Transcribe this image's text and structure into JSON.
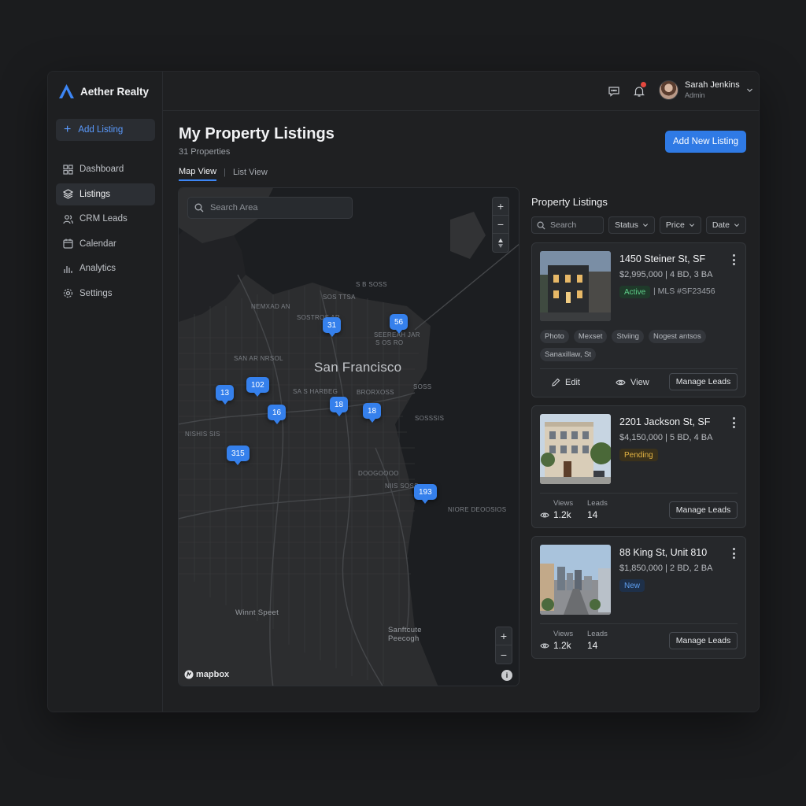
{
  "brand": {
    "name": "Aether Realty",
    "accent": "#3d86f5"
  },
  "sidebar": {
    "add_label": "Add Listing",
    "items": [
      {
        "label": "Dashboard",
        "icon": "grid-icon"
      },
      {
        "label": "Listings",
        "icon": "layers-icon",
        "active": true
      },
      {
        "label": "CRM Leads",
        "icon": "users-icon"
      },
      {
        "label": "Calendar",
        "icon": "calendar-icon"
      },
      {
        "label": "Analytics",
        "icon": "bar-chart-icon"
      },
      {
        "label": "Settings",
        "icon": "gear-icon"
      }
    ]
  },
  "topbar": {
    "user_name": "Sarah Jenkins",
    "user_role": "Admin"
  },
  "page": {
    "title": "My Property Listings",
    "subtitle": "31 Properties",
    "primary_button": "Add New Listing",
    "view_tabs": [
      "Map View",
      "List View"
    ]
  },
  "map": {
    "search_placeholder": "Search Area",
    "city": "San Francisco",
    "labels": [
      "S B SOSS",
      "NEMXAD AN",
      "SAN AR NRSOL",
      "SEEREAH JAR",
      "SOS TTSA",
      "SOSTROS AR",
      "S OS RO",
      "SA S HARBEG",
      "BRORXOSS",
      "NISHIS SIS",
      "SOSS",
      "SOSSSIS",
      "NIIS SOSS",
      "DOOGOOOO",
      "NIORE DEOOSIOS",
      "Winnt Speet",
      "Sanftcute Peecogh"
    ],
    "clusters": [
      "31",
      "56",
      "102",
      "13",
      "16",
      "18",
      "18",
      "315",
      "193"
    ],
    "zoom_in": "+",
    "zoom_out": "−",
    "attribution": "mapbox",
    "info": "i"
  },
  "panel": {
    "title": "Property Listings",
    "search_placeholder": "Search",
    "filters": [
      "Status",
      "Price",
      "Date"
    ],
    "listings": [
      {
        "address": "1450 Steiner St, SF",
        "price_line": "$2,995,000 | 4 BD, 3 BA",
        "status": "Active",
        "status_color": "#3fbf6a",
        "mls": "| MLS #SF23456",
        "tags": [
          "Photo",
          "Mexset",
          "Stviing",
          "Nogest antsos",
          "Sanaxillaw, St"
        ],
        "actions": [
          "Edit",
          "View"
        ],
        "manage": "Manage Leads"
      },
      {
        "address": "2201 Jackson St, SF",
        "price_line": "$4,150,000 | 5 BD, 4 BA",
        "status": "Pending",
        "status_color": "#e2b343",
        "views_label": "Views",
        "views": "1.2k",
        "leads_label": "Leads",
        "leads": "14",
        "manage": "Manage Leads"
      },
      {
        "address": "88 King St, Unit 810",
        "price_line": "$1,850,000 | 2 BD, 2 BA",
        "status": "New",
        "status_color": "#4f94f2",
        "views_label": "Views",
        "views": "1.2k",
        "leads_label": "Leads",
        "leads": "14",
        "manage": "Manage Leads"
      }
    ]
  }
}
